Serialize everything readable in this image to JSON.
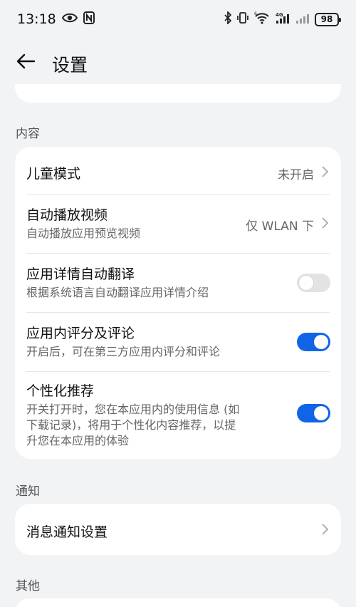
{
  "status_bar": {
    "time": "13:18",
    "battery": "98",
    "icons": [
      "eye-icon",
      "nfc-icon",
      "bluetooth-icon",
      "vibrate-icon",
      "wifi-icon",
      "signal-4g-icon",
      "signal-icon"
    ]
  },
  "header": {
    "title": "设置",
    "back_icon": "arrow-left-icon"
  },
  "sections": {
    "content": {
      "title": "内容",
      "items": {
        "kids_mode": {
          "title": "儿童模式",
          "value": "未开启"
        },
        "autoplay": {
          "title": "自动播放视频",
          "subtitle": "自动播放应用预览视频",
          "value": "仅 WLAN 下"
        },
        "auto_translate": {
          "title": "应用详情自动翻译",
          "subtitle": "根据系统语言自动翻译应用详情介绍",
          "toggle": false
        },
        "in_app_review": {
          "title": "应用内评分及评论",
          "subtitle": "开启后，可在第三方应用内评分和评论",
          "toggle": true
        },
        "personalized": {
          "title": "个性化推荐",
          "subtitle_lines": [
            "开关打开时，您在本应用内的使用信息 (如",
            "下载记录)，将用于个性化内容推荐，以提",
            "升您在本应用的体验"
          ],
          "toggle": true
        }
      }
    },
    "notifications": {
      "title": "通知",
      "items": {
        "message_settings": {
          "title": "消息通知设置"
        }
      }
    },
    "other": {
      "title": "其他"
    }
  },
  "colors": {
    "accent": "#1164e8",
    "background": "#f1f3f5",
    "card": "#ffffff"
  }
}
